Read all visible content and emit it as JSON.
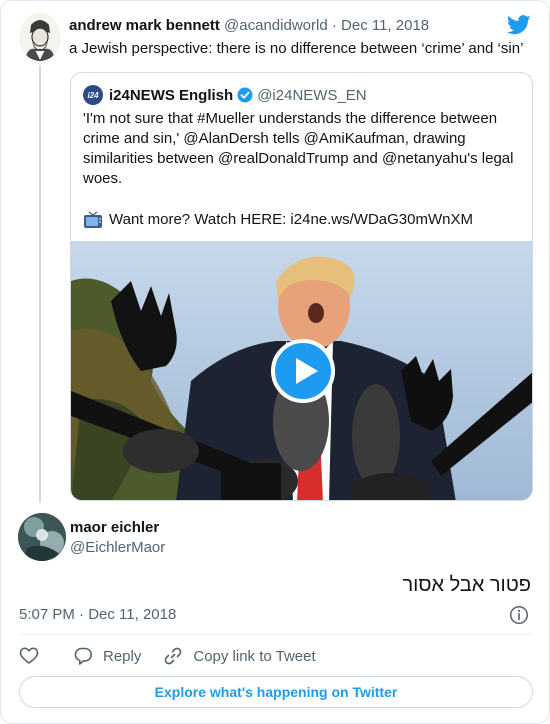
{
  "parent": {
    "name": "andrew mark bennett",
    "handle": "@acandidworld",
    "separator": "·",
    "date": "Dec 11, 2018",
    "text": "a Jewish perspective: there is no difference between ‘crime’ and ‘sin’"
  },
  "quote": {
    "logo_text": "i24",
    "name": "i24NEWS English",
    "handle": "@i24NEWS_EN",
    "text_lines": [
      "'I'm not sure that #Mueller understands the difference between",
      "crime and sin,' @AlanDersh tells @AmiKaufman, drawing",
      "similarities between @realDonaldTrump and @netanyahu's legal",
      "woes."
    ],
    "link_text": "Want more? Watch HERE: i24ne.ws/WDaG30mWnXM",
    "media_icon": "play-button-icon"
  },
  "reply": {
    "name": "maor eichler",
    "handle": "@EichlerMaor",
    "text": "פטור אבל אסור"
  },
  "timestamp": "5:07 PM · Dec 11, 2018",
  "actions": {
    "reply_label": "Reply",
    "copy_label": "Copy link to Tweet"
  },
  "explore_label": "Explore what's happening on Twitter",
  "colors": {
    "accent": "#1d9bf0",
    "text": "#0f1419",
    "muted": "#536471",
    "border": "#cfd9de"
  }
}
